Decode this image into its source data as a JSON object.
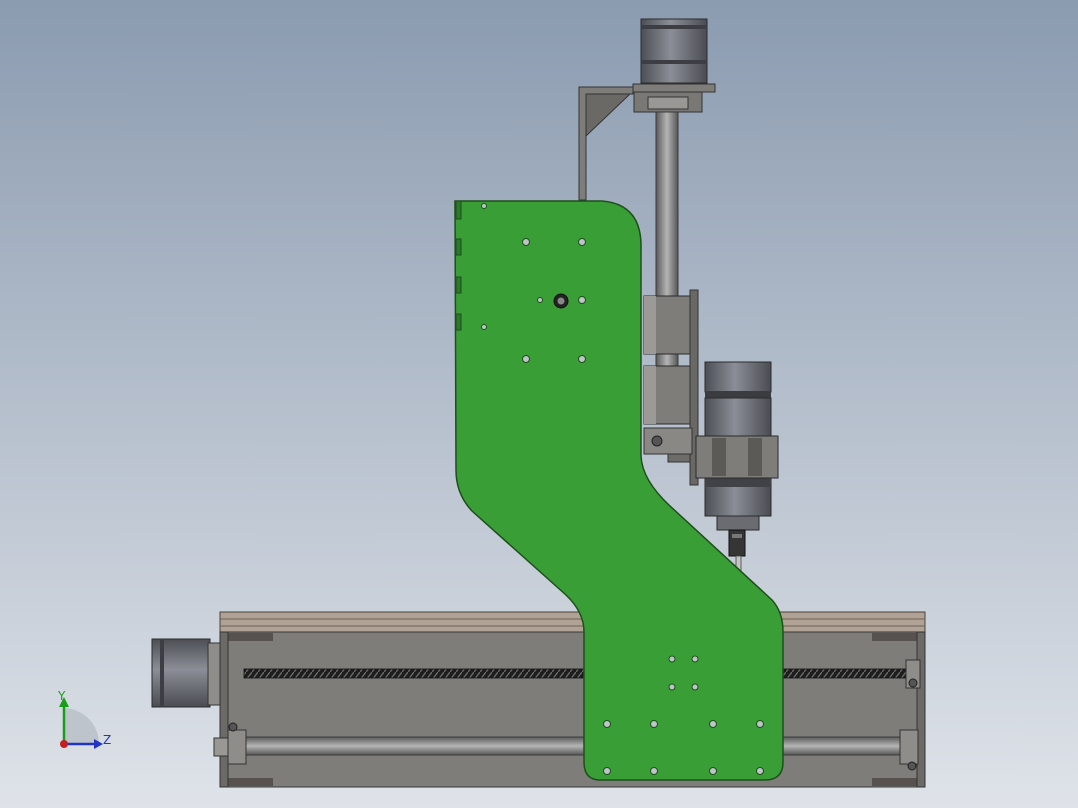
{
  "viewport": {
    "background_top": "#8b9bb0",
    "background_bottom": "#dfe3e9"
  },
  "model": {
    "plate_color": "#3a9e37",
    "plate_edge_color": "#1f4f1c",
    "frame_color": "#7f7d7a",
    "frame_dark_color": "#57524f",
    "wood_color": "#b0a294",
    "motor_color": "#6e7077",
    "screw_color": "#2f2f2f",
    "rod_color": "#8e8e8e"
  },
  "triad": {
    "y_label": "Y",
    "z_label": "Z",
    "y_color": "#1a9e1a",
    "z_color": "#2035c4",
    "x_color": "#c42020"
  }
}
